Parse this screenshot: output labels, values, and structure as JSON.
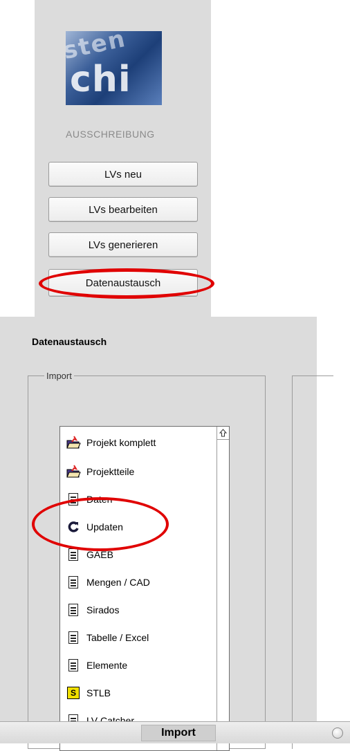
{
  "sidebar": {
    "logo_text_top": "sten",
    "logo_text_main": "chi",
    "heading": "AUSSCHREIBUNG",
    "buttons": [
      {
        "label": "LVs neu"
      },
      {
        "label": "LVs bearbeiten"
      },
      {
        "label": "LVs generieren"
      },
      {
        "label": "Datenaustausch"
      }
    ]
  },
  "main": {
    "section_title": "Datenaustausch",
    "group_label": "Import",
    "items": [
      {
        "label": "Projekt komplett",
        "icon": "folder-import-icon"
      },
      {
        "label": "Projektteile",
        "icon": "folder-import-icon"
      },
      {
        "label": "Daten",
        "icon": "document-icon"
      },
      {
        "label": "Updaten",
        "icon": "refresh-icon"
      },
      {
        "label": "GAEB",
        "icon": "document-icon"
      },
      {
        "label": "Mengen / CAD",
        "icon": "document-icon"
      },
      {
        "label": "Sirados",
        "icon": "document-icon"
      },
      {
        "label": "Tabelle / Excel",
        "icon": "document-icon"
      },
      {
        "label": "Elemente",
        "icon": "document-icon"
      },
      {
        "label": "STLB",
        "icon": "stlb-icon",
        "icon_glyph": "S"
      },
      {
        "label": "LV Catcher",
        "icon": "document-icon"
      }
    ]
  },
  "statusbar": {
    "label": "Import"
  },
  "colors": {
    "panel_bg": "#dcdcdc",
    "highlight_red": "#e00000",
    "stlb_yellow": "#f1e000"
  }
}
